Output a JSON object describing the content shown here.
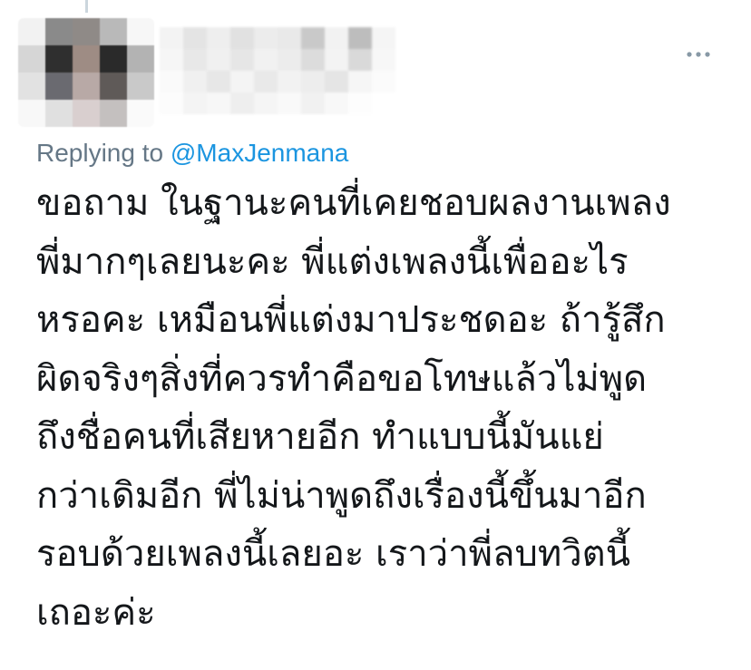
{
  "tweet": {
    "author_avatar_icon": "blurred-avatar-icon",
    "author_name_icon": "blurred-author-name-icon",
    "more_icon": "more-options-icon",
    "replying_prefix": "Replying to",
    "replying_handle": "@MaxJenmana",
    "text_lines": [
      "ขอถาม ในฐานะคนที่เคยชอบผลงานเพลง",
      "พี่มากๆเลยนะคะ พี่แต่งเพลงนี้เพื่ออะไร",
      "หรอคะ เหมือนพี่แต่งมาประชดอะ ถ้ารู้สึก",
      "ผิดจริงๆสิ่งที่ควรทำคือขอโทษแล้วไม่พูด",
      "ถึงชื่อคนที่เสียหายอีก ทำแบบนี้มันแย่",
      "กว่าเดิมอีก พี่ไม่น่าพูดถึงเรื่องนี้ขึ้นมาอีก",
      "รอบด้วยเพลงนี้เลยอะ เราว่าพี่ลบทวิตนี้",
      "เถอะค่ะ"
    ]
  },
  "colors": {
    "muted_text": "#657786",
    "link": "#1b95e0",
    "body_text": "#14171a",
    "icon": "#8899a6"
  }
}
